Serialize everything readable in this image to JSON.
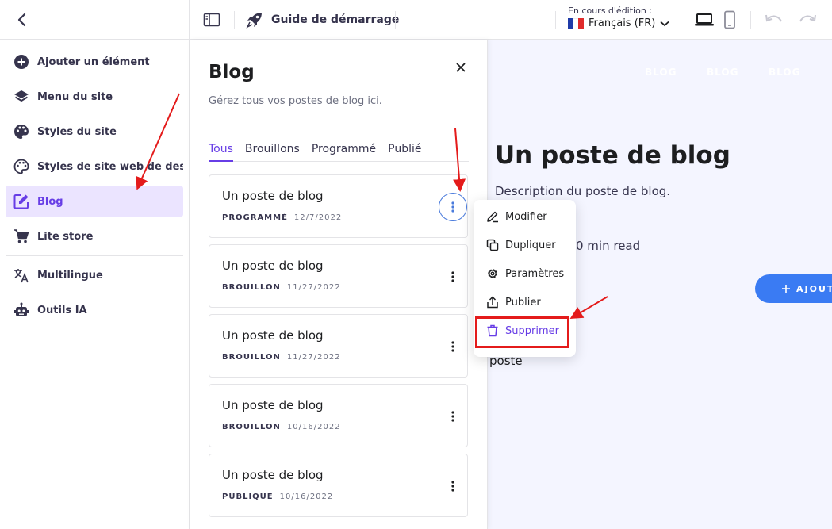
{
  "topbar": {
    "guide_label": "Guide de démarrage",
    "editing_caption": "En cours d'édition :",
    "language": "Français (FR)",
    "flag_colors": [
      "#1f3ba8",
      "#ffffff",
      "#e02b2b"
    ]
  },
  "sidebar": {
    "items": [
      {
        "label": "Ajouter un élément",
        "icon": "plus-circle-icon"
      },
      {
        "label": "Menu du site",
        "icon": "layers-icon"
      },
      {
        "label": "Styles du site",
        "icon": "palette-icon"
      },
      {
        "label": "Styles de site web de desi...",
        "icon": "palette-outline-icon"
      },
      {
        "label": "Blog",
        "icon": "edit-note-icon",
        "active": true
      },
      {
        "label": "Lite store",
        "icon": "cart-icon"
      },
      {
        "label": "Multilingue",
        "icon": "translate-icon"
      },
      {
        "label": "Outils IA",
        "icon": "robot-icon"
      }
    ]
  },
  "panel": {
    "title": "Blog",
    "subtitle": "Gérez tous vos postes de blog ici.",
    "tabs": [
      {
        "label": "Tous",
        "active": true
      },
      {
        "label": "Brouillons"
      },
      {
        "label": "Programmé"
      },
      {
        "label": "Publié"
      }
    ],
    "posts": [
      {
        "title": "Un poste de blog",
        "status": "PROGRAMMÉ",
        "date": "12/7/2022"
      },
      {
        "title": "Un poste de blog",
        "status": "BROUILLON",
        "date": "11/27/2022"
      },
      {
        "title": "Un poste de blog",
        "status": "BROUILLON",
        "date": "11/27/2022"
      },
      {
        "title": "Un poste de blog",
        "status": "BROUILLON",
        "date": "10/16/2022"
      },
      {
        "title": "Un poste de blog",
        "status": "PUBLIQUE",
        "date": "10/16/2022"
      }
    ]
  },
  "context_menu": {
    "items": [
      {
        "label": "Modifier",
        "icon": "pencil-icon"
      },
      {
        "label": "Dupliquer",
        "icon": "duplicate-icon"
      },
      {
        "label": "Paramètres",
        "icon": "gear-icon"
      },
      {
        "label": "Publier",
        "icon": "upload-icon"
      },
      {
        "label": "Supprimer",
        "icon": "trash-icon"
      }
    ]
  },
  "preview": {
    "nav": [
      "BLOG",
      "BLOG",
      "BLOG"
    ],
    "title": "Un poste de blog",
    "description": "Description du poste de blog.",
    "read_time": "0 min read",
    "add_button": "AJOUT",
    "poste_text": "poste"
  },
  "colors": {
    "accent": "#673de6",
    "accent_light": "#ebe4ff",
    "annotation_red": "#e41b1b",
    "preview_button": "#3a7bf3"
  }
}
